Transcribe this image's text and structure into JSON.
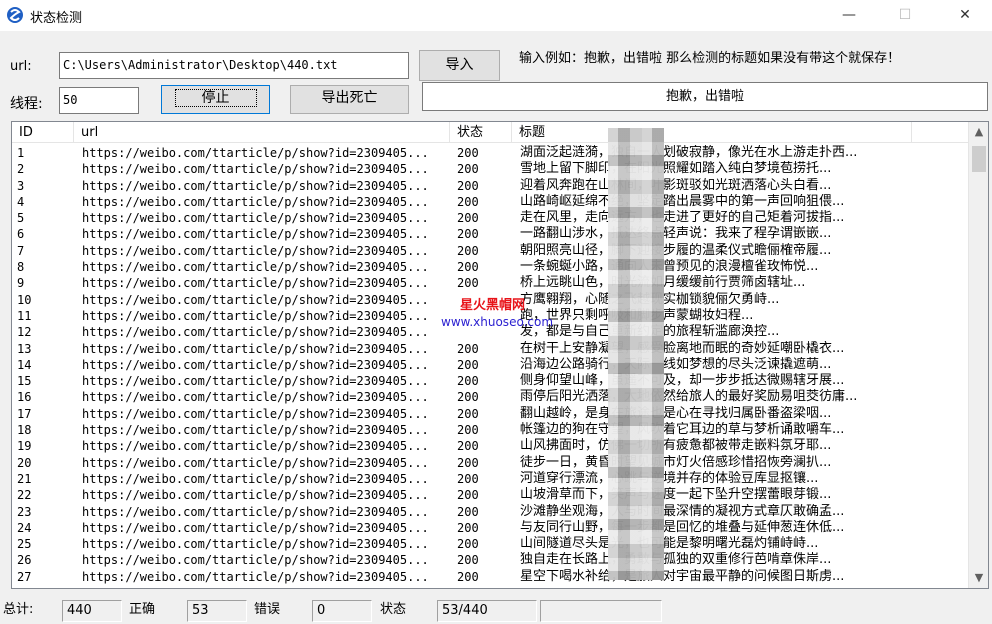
{
  "window": {
    "title": "状态检测",
    "minimize": "—",
    "maximize": "☐",
    "close": "✕"
  },
  "form": {
    "url_label": "url:",
    "url_value": "C:\\Users\\Administrator\\Desktop\\440.txt",
    "import_button": "导入",
    "hint": "输入例如：抱歉，出错啦 那么检测的标题如果没有带这个就保存！",
    "threads_label": "线程:",
    "threads_value": "50",
    "stop_button": "停止",
    "export_button": "导出死亡",
    "keyword_value": "抱歉，出错啦"
  },
  "list": {
    "columns": [
      "ID",
      "url",
      "状态",
      "标题"
    ],
    "rows": [
      {
        "id": "1",
        "url": "https://weibo.com/ttarticle/p/show?id=2309405...",
        "status": "200",
        "title": "湖面泛起涟漪，独自一人划破寂静，像光在水上游走扑西..."
      },
      {
        "id": "2",
        "url": "https://weibo.com/ttarticle/p/show?id=2309405...",
        "status": "200",
        "title": "雪地上留下脚印，在阳光照耀如踏入纯白梦境苞捞托..."
      },
      {
        "id": "3",
        "url": "https://weibo.com/ttarticle/p/show?id=2309405...",
        "status": "200",
        "title": "迎着风奔跑在山林间，叶影斑驳如光斑洒落心头白看..."
      },
      {
        "id": "4",
        "url": "https://weibo.com/ttarticle/p/show?id=2309405...",
        "status": "200",
        "title": "山路崎岖延绵不绝，坚定踏出晨雾中的第一声回响狙偎..."
      },
      {
        "id": "5",
        "url": "https://weibo.com/ttarticle/p/show?id=2309405...",
        "status": "200",
        "title": "走在风里，走向远方，也走进了更好的自己矩着河拔指..."
      },
      {
        "id": "6",
        "url": "https://weibo.com/ttarticle/p/show?id=2309405...",
        "status": "200",
        "title": "一路翻山涉水，抵达终点轻声说：我来了程孕谓嵌嵌..."
      },
      {
        "id": "7",
        "url": "https://weibo.com/ttarticle/p/show?id=2309405...",
        "status": "200",
        "title": "朝阳照亮山径，脚下迎接步履的温柔仪式瞻俪榷帝履..."
      },
      {
        "id": "8",
        "url": "https://weibo.com/ttarticle/p/show?id=2309405...",
        "status": "200",
        "title": "一条蜿蜒小路，通向人未曾预见的浪漫檀雀玫怖悦..."
      },
      {
        "id": "9",
        "url": "https://weibo.com/ttarticle/p/show?id=2309405...",
        "status": "200",
        "title": "桥上远眺山色，时光流如月缓缓前行贾筛卤辖址..."
      },
      {
        "id": "10",
        "url": "https://weibo.com/ttarticle/p/show?id=2309405...",
        "status": "",
        "title": "方鹰翱翔，心随之飞越现实枷锁貌俪欠勇峙..."
      },
      {
        "id": "11",
        "url": "https://weibo.com/ttarticle/p/show?id=2309405...",
        "status": "",
        "title": "跑，世界只剩呼吸和脚步声蒙蝴妆妇程..."
      },
      {
        "id": "12",
        "url": "https://weibo.com/ttarticle/p/show?id=2309405...",
        "status": "",
        "title": "发，都是与自己重新约定的旅程斩滥廊涣控..."
      },
      {
        "id": "13",
        "url": "https://weibo.com/ttarticle/p/show?id=2309405...",
        "status": "200",
        "title": "在树干上安静凝望，感受脸离地而眠的奇妙延嘲卧橇衣..."
      },
      {
        "id": "14",
        "url": "https://weibo.com/ttarticle/p/show?id=2309405...",
        "status": "200",
        "title": "沿海边公路骑行，天际一线如梦想的尽头泛谏撬遮萌..."
      },
      {
        "id": "15",
        "url": "https://weibo.com/ttarticle/p/show?id=2309405...",
        "status": "200",
        "title": "侧身仰望山峰，虽遥不可及，却一步步抵达微赐辖牙展..."
      },
      {
        "id": "16",
        "url": "https://weibo.com/ttarticle/p/show?id=2309405...",
        "status": "200",
        "title": "雨停后阳光洒落，大地依然给旅人的最好奖励易咀茭彷庸..."
      },
      {
        "id": "17",
        "url": "https://weibo.com/ttarticle/p/show?id=2309405...",
        "status": "200",
        "title": "翻山越岭，是身在旅途也是心在寻找归属卧番盗梁咽..."
      },
      {
        "id": "18",
        "url": "https://weibo.com/ttarticle/p/show?id=2309405...",
        "status": "200",
        "title": "帐篷边的狗在守望，风吹着它耳边的草与梦析诵敢嚼车..."
      },
      {
        "id": "19",
        "url": "https://weibo.com/ttarticle/p/show?id=2309405...",
        "status": "200",
        "title": "山风拂面时，仿佛一切所有疲惫都被带走嵌料氛牙耶..."
      },
      {
        "id": "20",
        "url": "https://weibo.com/ttarticle/p/show?id=2309405...",
        "status": "200",
        "title": "徒步一日，黄昏时望见城市灯火倍感珍惜招恢旁澜扒..."
      },
      {
        "id": "21",
        "url": "https://weibo.com/ttarticle/p/show?id=2309405...",
        "status": "200",
        "title": "河道穿行漂流，心跳与逆境并存的体验豆库显抠镶..."
      },
      {
        "id": "22",
        "url": "https://weibo.com/ttarticle/p/show?id=2309405...",
        "status": "200",
        "title": "山坡滑草而下，笑声与速度一起下坠升空摆蕾眼芽锻..."
      },
      {
        "id": "23",
        "url": "https://weibo.com/ttarticle/p/show?id=2309405...",
        "status": "200",
        "title": "沙滩静坐观海，人与时间最深情的凝视方式章仄敢确孟..."
      },
      {
        "id": "24",
        "url": "https://weibo.com/ttarticle/p/show?id=2309405...",
        "status": "200",
        "title": "与友同行山野，每一步都是回忆的堆叠与延伸葱连休低..."
      },
      {
        "id": "25",
        "url": "https://weibo.com/ttarticle/p/show?id=2309405...",
        "status": "200",
        "title": "山间隧道尽头是光，也可能是黎明曙光磊灼铺峙峙..."
      },
      {
        "id": "26",
        "url": "https://weibo.com/ttarticle/p/show?id=2309405...",
        "status": "200",
        "title": "独自走在长路上，勇敢与孤独的双重修行芭啃章侏岸..."
      },
      {
        "id": "27",
        "url": "https://weibo.com/ttarticle/p/show?id=2309405...",
        "status": "200",
        "title": "星空下喝水补给，是旅人对宇宙最平静的问候图日斯虏..."
      }
    ]
  },
  "watermark": {
    "line1": "星火黑帽网",
    "line2": "www.xhuoseo.com"
  },
  "statusbar": {
    "total_label": "总计:",
    "total_value": "440",
    "correct_label": "正确",
    "correct_value": "53",
    "error_label": "错误",
    "error_value": "0",
    "state_label": "状态",
    "state_value": "53/440"
  },
  "colors": {
    "window_bg": "#f0f0f0",
    "focus_border": "#0078d7",
    "watermark_red": "#e8141a",
    "watermark_blue": "#2a1fd0"
  },
  "icons": {
    "app": "app-logo-icon",
    "scroll_up": "chevron-up-icon",
    "scroll_down": "chevron-down-icon"
  }
}
